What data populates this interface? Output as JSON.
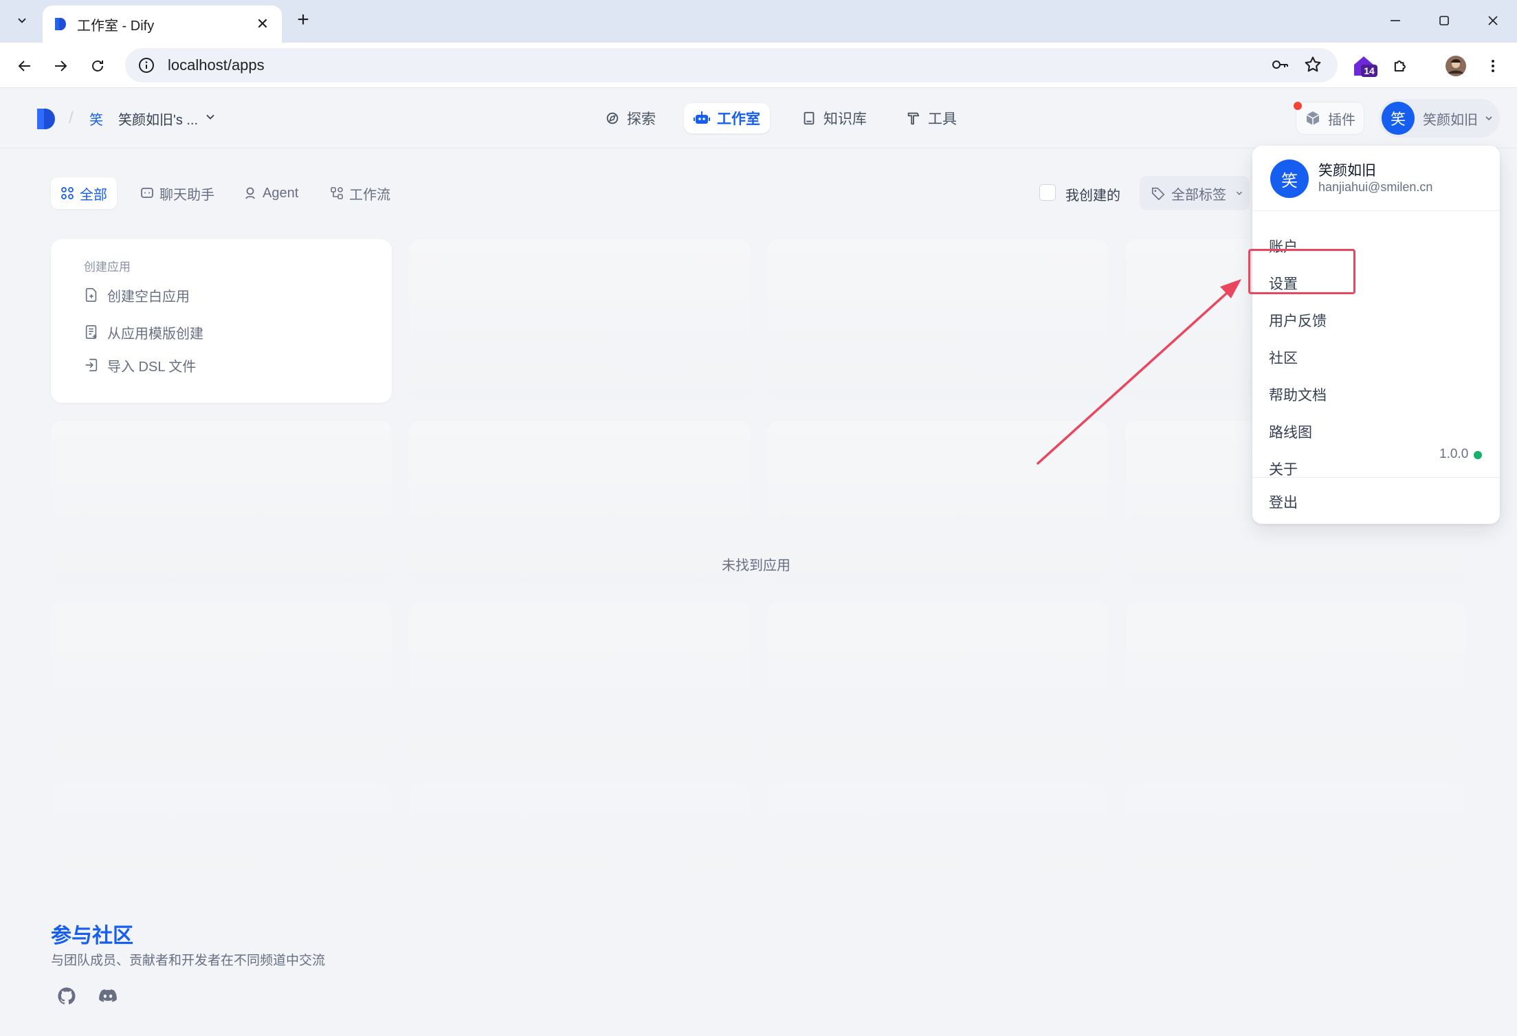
{
  "browser": {
    "tab_title": "工作室 - Dify",
    "url": "localhost/apps",
    "extension_badge": "14"
  },
  "header": {
    "workspace_avatar": "笑",
    "workspace_name": "笑颜如旧's ...",
    "nav": [
      {
        "label": "探索",
        "icon": "compass-icon"
      },
      {
        "label": "工作室",
        "icon": "robot-icon",
        "active": true
      },
      {
        "label": "知识库",
        "icon": "book-icon"
      },
      {
        "label": "工具",
        "icon": "hammer-icon"
      }
    ],
    "plugin_label": "插件",
    "user_avatar": "笑",
    "user_name": "笑颜如旧"
  },
  "filters": {
    "tabs": [
      {
        "label": "全部",
        "icon": "grid-icon",
        "active": true
      },
      {
        "label": "聊天助手",
        "icon": "chat-icon"
      },
      {
        "label": "Agent",
        "icon": "agent-icon"
      },
      {
        "label": "工作流",
        "icon": "workflow-icon"
      }
    ],
    "mine_label": "我创建的",
    "tag_label": "全部标签"
  },
  "create_card": {
    "title": "创建应用",
    "items": [
      {
        "label": "创建空白应用",
        "icon": "file-plus-icon"
      },
      {
        "label": "从应用模版创建",
        "icon": "template-icon"
      },
      {
        "label": "导入 DSL 文件",
        "icon": "import-icon"
      }
    ]
  },
  "empty_text": "未找到应用",
  "footer": {
    "title": "参与社区",
    "subtitle": "与团队成员、贡献者和开发者在不同频道中交流"
  },
  "dropdown": {
    "avatar": "笑",
    "name": "笑颜如旧",
    "email": "hanjiahui@smilen.cn",
    "items": [
      "账户",
      "设置",
      "用户反馈",
      "社区",
      "帮助文档",
      "路线图",
      "关于"
    ],
    "version": "1.0.0",
    "logout": "登出"
  },
  "colors": {
    "accent": "#155eef",
    "highlight": "#e8475f",
    "status_green": "#17b26a"
  }
}
